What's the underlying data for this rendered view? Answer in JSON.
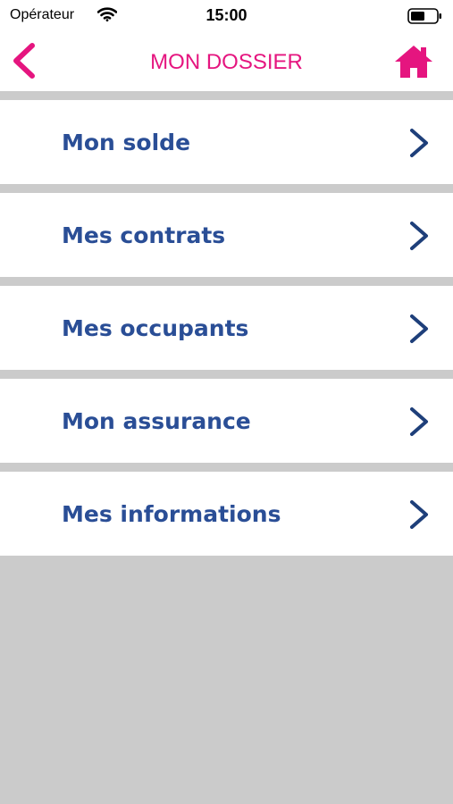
{
  "status_bar": {
    "carrier": "Opérateur",
    "time": "15:00",
    "wifi_icon": "wifi-icon",
    "battery_icon": "battery-icon"
  },
  "nav_bar": {
    "title": "MON DOSSIER",
    "back_icon": "chevron-left-icon",
    "home_icon": "home-icon"
  },
  "menu": {
    "items": [
      {
        "label": "Mon solde"
      },
      {
        "label": "Mes contrats"
      },
      {
        "label": "Mes occupants"
      },
      {
        "label": "Mon assurance"
      },
      {
        "label": "Mes informations"
      }
    ],
    "chevron_icon": "chevron-right-icon"
  },
  "colors": {
    "accent": "#e5157f",
    "label": "#2a4e96",
    "chevron": "#1e3f7a",
    "separator": "#cbcbcb"
  }
}
